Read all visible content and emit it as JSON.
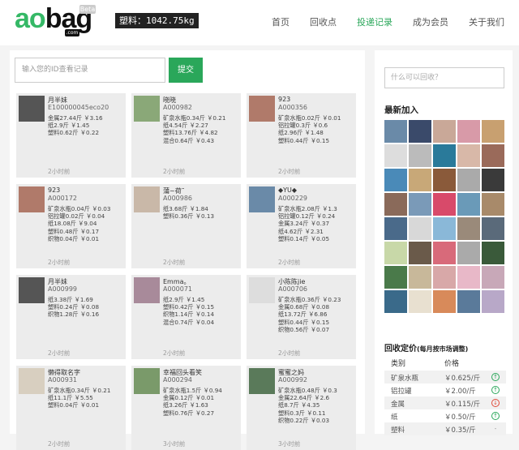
{
  "header": {
    "logo_ao": "ao",
    "logo_bag": "bag",
    "logo_beta": "Beta",
    "logo_com": ".com",
    "plastic_total": "塑料：1042.75kg",
    "nav": [
      "首页",
      "回收点",
      "投递记录",
      "成为会员",
      "关于我们"
    ],
    "active_nav": "投递记录"
  },
  "search": {
    "placeholder": "输入您的ID查看记录",
    "button": "提交"
  },
  "records": [
    {
      "name": "月半妹",
      "id": "E100000045eco20",
      "lines": [
        "金属27.44斤 ￥3.16",
        "纸2.9斤 ￥1.45",
        "塑料0.62斤 ￥0.22"
      ],
      "time": "2小时前",
      "avatar_color": "#555"
    },
    {
      "name": "晓晓",
      "id": "A000982",
      "lines": [
        "矿泉水瓶0.34斤 ￥0.21",
        "纸4.54斤 ￥2.27",
        "塑料13.76斤 ￥4.82",
        "混合0.64斤 ￥0.43"
      ],
      "time": "2小时前",
      "avatar_color": "#8aa878"
    },
    {
      "name": "923",
      "id": "A000356",
      "lines": [
        "矿泉水瓶0.02斤 ￥0.01",
        "铝拉罐0.3斤 ￥0.6",
        "纸2.96斤 ￥1.48",
        "塑料0.44斤 ￥0.15"
      ],
      "time": "2小时前",
      "avatar_color": "#b07a6a"
    },
    {
      "name": "923",
      "id": "A000172",
      "lines": [
        "矿泉水瓶0.04斤 ￥0.03",
        "铝拉罐0.02斤 ￥0.04",
        "纸18.08斤 ￥9.04",
        "塑料0.48斤 ￥0.17",
        "织物0.04斤 ￥0.01"
      ],
      "time": "2小时前",
      "avatar_color": "#b07a6a"
    },
    {
      "name": "蒲~荷˜",
      "id": "A000986",
      "lines": [
        "纸3.68斤 ￥1.84",
        "塑料0.36斤 ￥0.13"
      ],
      "time": "2小时前",
      "avatar_color": "#c9b8a8"
    },
    {
      "name": "◆YU◆",
      "id": "A000229",
      "lines": [
        "矿泉水瓶2.08斤 ￥1.3",
        "铝拉罐0.12斤 ￥0.24",
        "金属3.24斤 ￥0.37",
        "纸4.62斤 ￥2.31",
        "塑料0.14斤 ￥0.05"
      ],
      "time": "2小时前",
      "avatar_color": "#6a8aa8"
    },
    {
      "name": "月半妹",
      "id": "A000999",
      "lines": [
        "纸3.38斤 ￥1.69",
        "塑料0.24斤 ￥0.08",
        "织物1.28斤 ￥0.16"
      ],
      "time": "2小时前",
      "avatar_color": "#555"
    },
    {
      "name": "Emma。",
      "id": "A000071",
      "lines": [
        "纸2.9斤 ￥1.45",
        "塑料0.42斤 ￥0.15",
        "织物1.14斤 ￥0.14",
        "混合0.74斤 ￥0.04"
      ],
      "time": "2小时前",
      "avatar_color": "#a88a9a"
    },
    {
      "name": "小陈陈jie",
      "id": "A000706",
      "lines": [
        "矿泉水瓶0.36斤 ￥0.23",
        "金属0.68斤 ￥0.08",
        "纸13.72斤 ￥6.86",
        "塑料0.44斤 ￥0.15",
        "织物0.56斤 ￥0.07"
      ],
      "time": "2小时前",
      "avatar_color": "#ddd"
    },
    {
      "name": "懒得取名字",
      "id": "A000931",
      "lines": [
        "矿泉水瓶0.34斤 ￥0.21",
        "纸11.1斤 ￥5.55",
        "塑料0.04斤 ￥0.01"
      ],
      "time": "2小时前",
      "avatar_color": "#d8cfc0"
    },
    {
      "name": "幸福回头看笑",
      "id": "A000294",
      "lines": [
        "矿泉水瓶1.5斤 ￥0.94",
        "金属0.12斤 ￥0.01",
        "纸3.26斤 ￥1.63",
        "塑料0.76斤 ￥0.27"
      ],
      "time": "3小时前",
      "avatar_color": "#7a9a6a"
    },
    {
      "name": "蜜蜜之妈",
      "id": "A000992",
      "lines": [
        "矿泉水瓶0.48斤 ￥0.3",
        "金属22.64斤 ￥2.6",
        "纸8.7斤 ￥4.35",
        "塑料0.3斤 ￥0.11",
        "织物0.22斤 ￥0.03"
      ],
      "time": "3小时前",
      "avatar_color": "#5a7a5a"
    }
  ],
  "sidebar": {
    "search_placeholder": "什么可以回收？",
    "new_members_title": "最新加入",
    "thumb_colors": [
      "#6a8aa8",
      "#3a4a6a",
      "#c9a898",
      "#d89aa8",
      "#c8a070",
      "#ddd",
      "#bbb",
      "#2a7a9a",
      "#d8b8a8",
      "#9a6a5a",
      "#4a8ab8",
      "#c8a878",
      "#8a5a3a",
      "#aaa",
      "#3a3a3a",
      "#8a6a5a",
      "#7a9ab8",
      "#d84a6a",
      "#6a9ab8",
      "#a88a6a",
      "#4a6a8a",
      "#d8d8d8",
      "#8ab8d8",
      "#9a8a7a",
      "#5a6a7a",
      "#c8d8a8",
      "#6a5a4a",
      "#d86a7a",
      "#aaa",
      "#3a5a3a",
      "#4a7a4a",
      "#c8b89a",
      "#d8a8a8",
      "#e8b8c8",
      "#c8a8b8",
      "#3a6a8a",
      "#e8e0d0",
      "#d88a5a",
      "#5a7a9a",
      "#b8a8c8"
    ],
    "price_title": "回收定价",
    "price_note": "(每月按市场调整)",
    "price_headers": [
      "类别",
      "价格"
    ],
    "prices": [
      {
        "cat": "矿泉水瓶",
        "price": "￥0.625/斤",
        "trend": "up"
      },
      {
        "cat": "铝拉罐",
        "price": "￥2.00/斤",
        "trend": "up"
      },
      {
        "cat": "金属",
        "price": "￥0.115/斤",
        "trend": "down"
      },
      {
        "cat": "纸",
        "price": "￥0.50/斤",
        "trend": "up"
      },
      {
        "cat": "塑料",
        "price": "￥0.35/斤",
        "trend": "flat"
      }
    ]
  }
}
